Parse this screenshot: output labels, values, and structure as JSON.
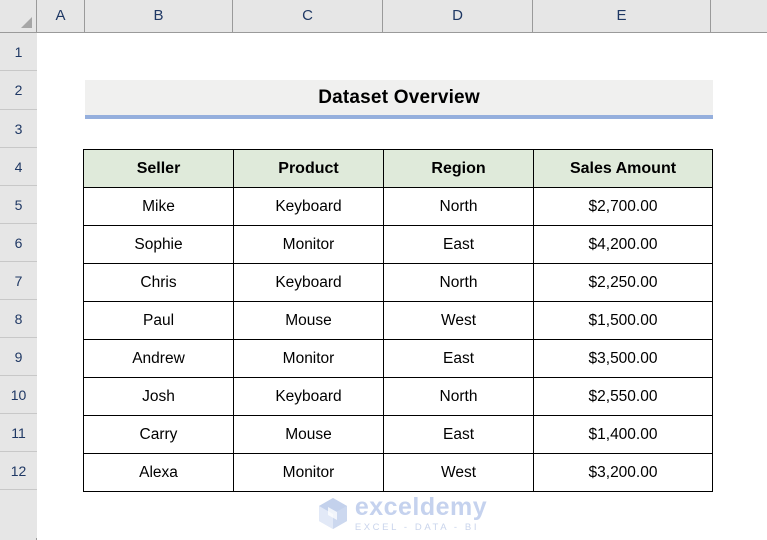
{
  "app": {
    "type": "spreadsheet",
    "corner_icon": "select-all-triangle-icon"
  },
  "grid": {
    "column_headers": [
      "A",
      "B",
      "C",
      "D",
      "E"
    ],
    "row_headers": [
      "1",
      "2",
      "3",
      "4",
      "5",
      "6",
      "7",
      "8",
      "9",
      "10",
      "11",
      "12"
    ]
  },
  "title": {
    "text": "Dataset Overview",
    "band_color": "#f0f0ef",
    "underline_color": "#95afdd"
  },
  "table": {
    "header_fill": "#dfeada",
    "border_color": "#000000",
    "columns": [
      "Seller",
      "Product",
      "Region",
      "Sales Amount"
    ],
    "rows": [
      {
        "seller": "Mike",
        "product": "Keyboard",
        "region": "North",
        "amount": "$2,700.00"
      },
      {
        "seller": "Sophie",
        "product": "Monitor",
        "region": "East",
        "amount": "$4,200.00"
      },
      {
        "seller": "Chris",
        "product": "Keyboard",
        "region": "North",
        "amount": "$2,250.00"
      },
      {
        "seller": "Paul",
        "product": "Mouse",
        "region": "West",
        "amount": "$1,500.00"
      },
      {
        "seller": "Andrew",
        "product": "Monitor",
        "region": "East",
        "amount": "$3,500.00"
      },
      {
        "seller": "Josh",
        "product": "Keyboard",
        "region": "North",
        "amount": "$2,550.00"
      },
      {
        "seller": "Carry",
        "product": "Mouse",
        "region": "East",
        "amount": "$1,400.00"
      },
      {
        "seller": "Alexa",
        "product": "Monitor",
        "region": "West",
        "amount": "$3,200.00"
      }
    ]
  },
  "watermark": {
    "brand": "exceldemy",
    "tagline": "EXCEL - DATA - BI",
    "logo_icon": "exceldemy-cube-logo-icon",
    "color": "#c5d2ee"
  }
}
